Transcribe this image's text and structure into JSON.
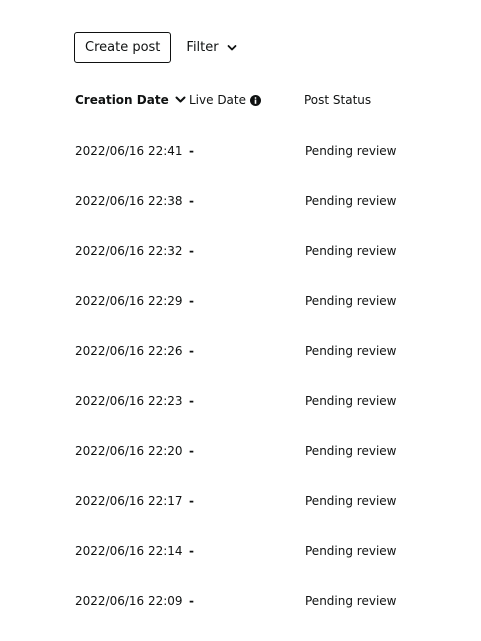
{
  "toolbar": {
    "create_label": "Create post",
    "filter_label": "Filter"
  },
  "table": {
    "columns": [
      "Creation Date",
      "Live Date",
      "Post Status"
    ],
    "sort_column": "Creation Date",
    "rows": [
      {
        "creation_date": "2022/06/16 22:41",
        "live_date": "-",
        "status": "Pending review"
      },
      {
        "creation_date": "2022/06/16 22:38",
        "live_date": "-",
        "status": "Pending review"
      },
      {
        "creation_date": "2022/06/16 22:32",
        "live_date": "-",
        "status": "Pending review"
      },
      {
        "creation_date": "2022/06/16 22:29",
        "live_date": "-",
        "status": "Pending review"
      },
      {
        "creation_date": "2022/06/16 22:26",
        "live_date": "-",
        "status": "Pending review"
      },
      {
        "creation_date": "2022/06/16 22:23",
        "live_date": "-",
        "status": "Pending review"
      },
      {
        "creation_date": "2022/06/16 22:20",
        "live_date": "-",
        "status": "Pending review"
      },
      {
        "creation_date": "2022/06/16 22:17",
        "live_date": "-",
        "status": "Pending review"
      },
      {
        "creation_date": "2022/06/16 22:14",
        "live_date": "-",
        "status": "Pending review"
      },
      {
        "creation_date": "2022/06/16 22:09",
        "live_date": "-",
        "status": "Pending review"
      }
    ]
  },
  "icons": {
    "filter": "chevron-down-icon",
    "sort": "chevron-down-icon",
    "live_date_info": "info-icon"
  },
  "colors": {
    "text": "#0f1111",
    "button_border": "#0f1111",
    "background": "#ffffff"
  }
}
